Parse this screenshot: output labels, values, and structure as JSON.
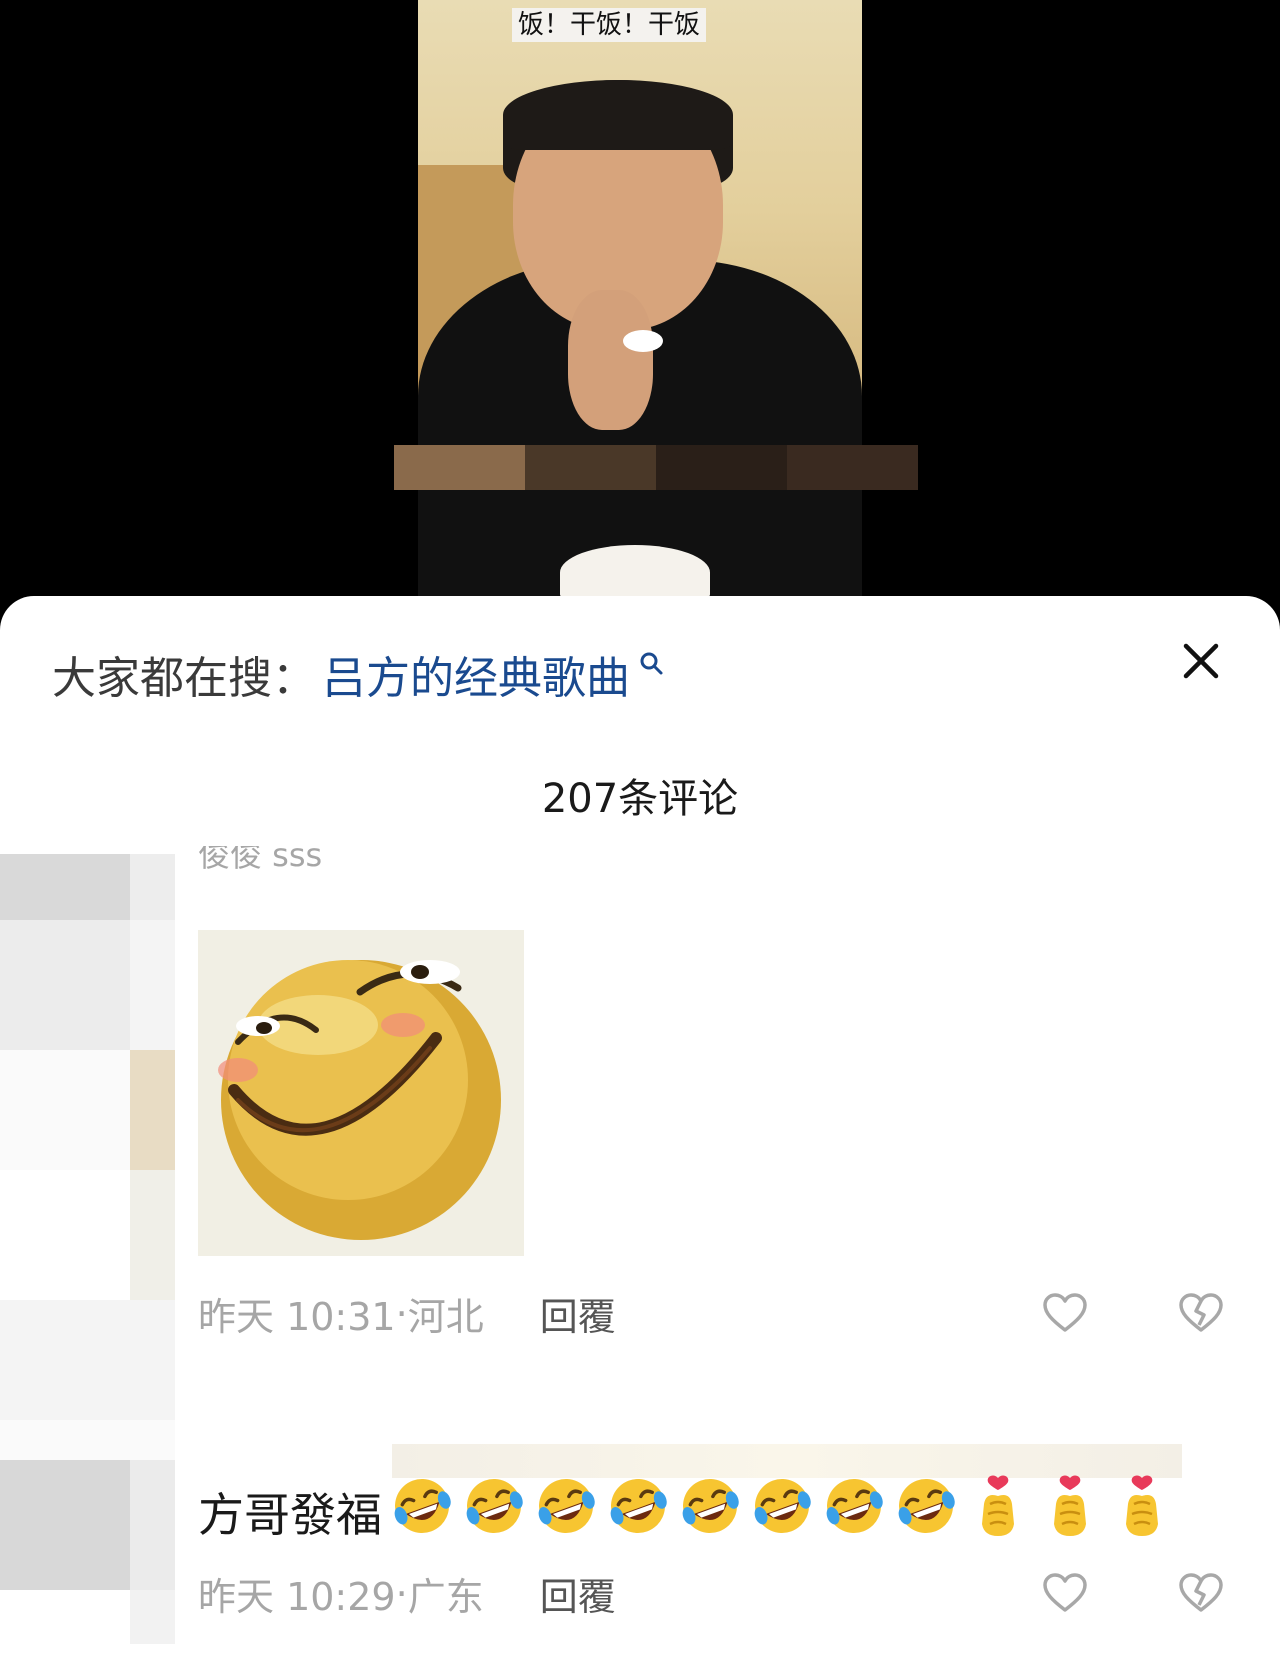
{
  "video": {
    "caption": "饭！干饭！干饭"
  },
  "sheet": {
    "search_prefix": "大家都在搜：",
    "search_query": "吕方的经典歌曲",
    "comment_count": "207条评论"
  },
  "comments": [
    {
      "author_partial": "俊俊 sss",
      "time": "昨天 10:31",
      "location": "河北",
      "reply_label": "回覆"
    },
    {
      "text": "方哥發福",
      "emojis": [
        "rofl",
        "rofl",
        "rofl",
        "rofl",
        "rofl",
        "rofl",
        "rofl",
        "rofl",
        "finger-heart",
        "finger-heart",
        "finger-heart"
      ],
      "time": "昨天 10:29",
      "location": "广东",
      "reply_label": "回覆"
    }
  ]
}
